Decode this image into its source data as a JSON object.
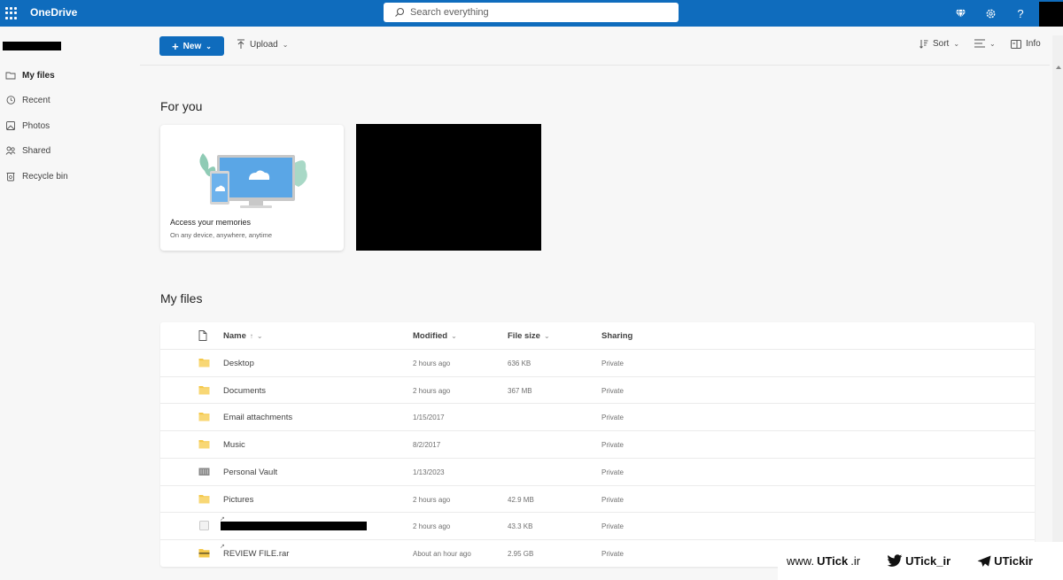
{
  "app": {
    "brand": "OneDrive",
    "search_placeholder": "Search everything",
    "colors": {
      "accent": "#0f6cbd",
      "folder": "#f4c84a"
    }
  },
  "topbar_icons": [
    "premium-diamond-icon",
    "settings-gear-icon",
    "help-question-icon"
  ],
  "help_glyph": "?",
  "sidebar": {
    "items": [
      {
        "label": "My files",
        "icon": "folder-icon",
        "active": true
      },
      {
        "label": "Recent",
        "icon": "recent-clock-icon",
        "active": false
      },
      {
        "label": "Photos",
        "icon": "photos-icon",
        "active": false
      },
      {
        "label": "Shared",
        "icon": "shared-people-icon",
        "active": false
      },
      {
        "label": "Recycle bin",
        "icon": "recycle-bin-icon",
        "active": false
      }
    ]
  },
  "toolbar": {
    "new_label": "New",
    "upload_label": "Upload",
    "sort_label": "Sort",
    "info_label": "Info"
  },
  "for_you": {
    "title": "For you",
    "card": {
      "title": "Access your memories",
      "subtitle": "On any device, anywhere, anytime"
    }
  },
  "my_files": {
    "title": "My files",
    "columns": {
      "name": "Name",
      "name_sort": "↑",
      "modified": "Modified",
      "size": "File size",
      "sharing": "Sharing"
    },
    "rows": [
      {
        "name": "Desktop",
        "type": "folder",
        "modified": "2 hours ago",
        "size": "636 KB",
        "sharing": "Private"
      },
      {
        "name": "Documents",
        "type": "folder",
        "modified": "2 hours ago",
        "size": "367 MB",
        "sharing": "Private"
      },
      {
        "name": "Email attachments",
        "type": "folder",
        "modified": "1/15/2017",
        "size": "",
        "sharing": "Private"
      },
      {
        "name": "Music",
        "type": "folder",
        "modified": "8/2/2017",
        "size": "",
        "sharing": "Private"
      },
      {
        "name": "Personal Vault",
        "type": "vault",
        "modified": "1/13/2023",
        "size": "",
        "sharing": "Private"
      },
      {
        "name": "Pictures",
        "type": "folder",
        "modified": "2 hours ago",
        "size": "42.9 MB",
        "sharing": "Private"
      },
      {
        "name": "",
        "type": "file-redacted",
        "modified": "2 hours ago",
        "size": "43.3 KB",
        "sharing": "Private"
      },
      {
        "name": "REVIEW FILE.rar",
        "type": "archive",
        "modified": "About an hour ago",
        "size": "2.95 GB",
        "sharing": "Private"
      }
    ]
  },
  "watermark": {
    "site_prefix": "www.",
    "site_main": "UTick",
    "site_suffix": ".ir",
    "twitter": "UTick_ir",
    "telegram": "UTickir"
  }
}
